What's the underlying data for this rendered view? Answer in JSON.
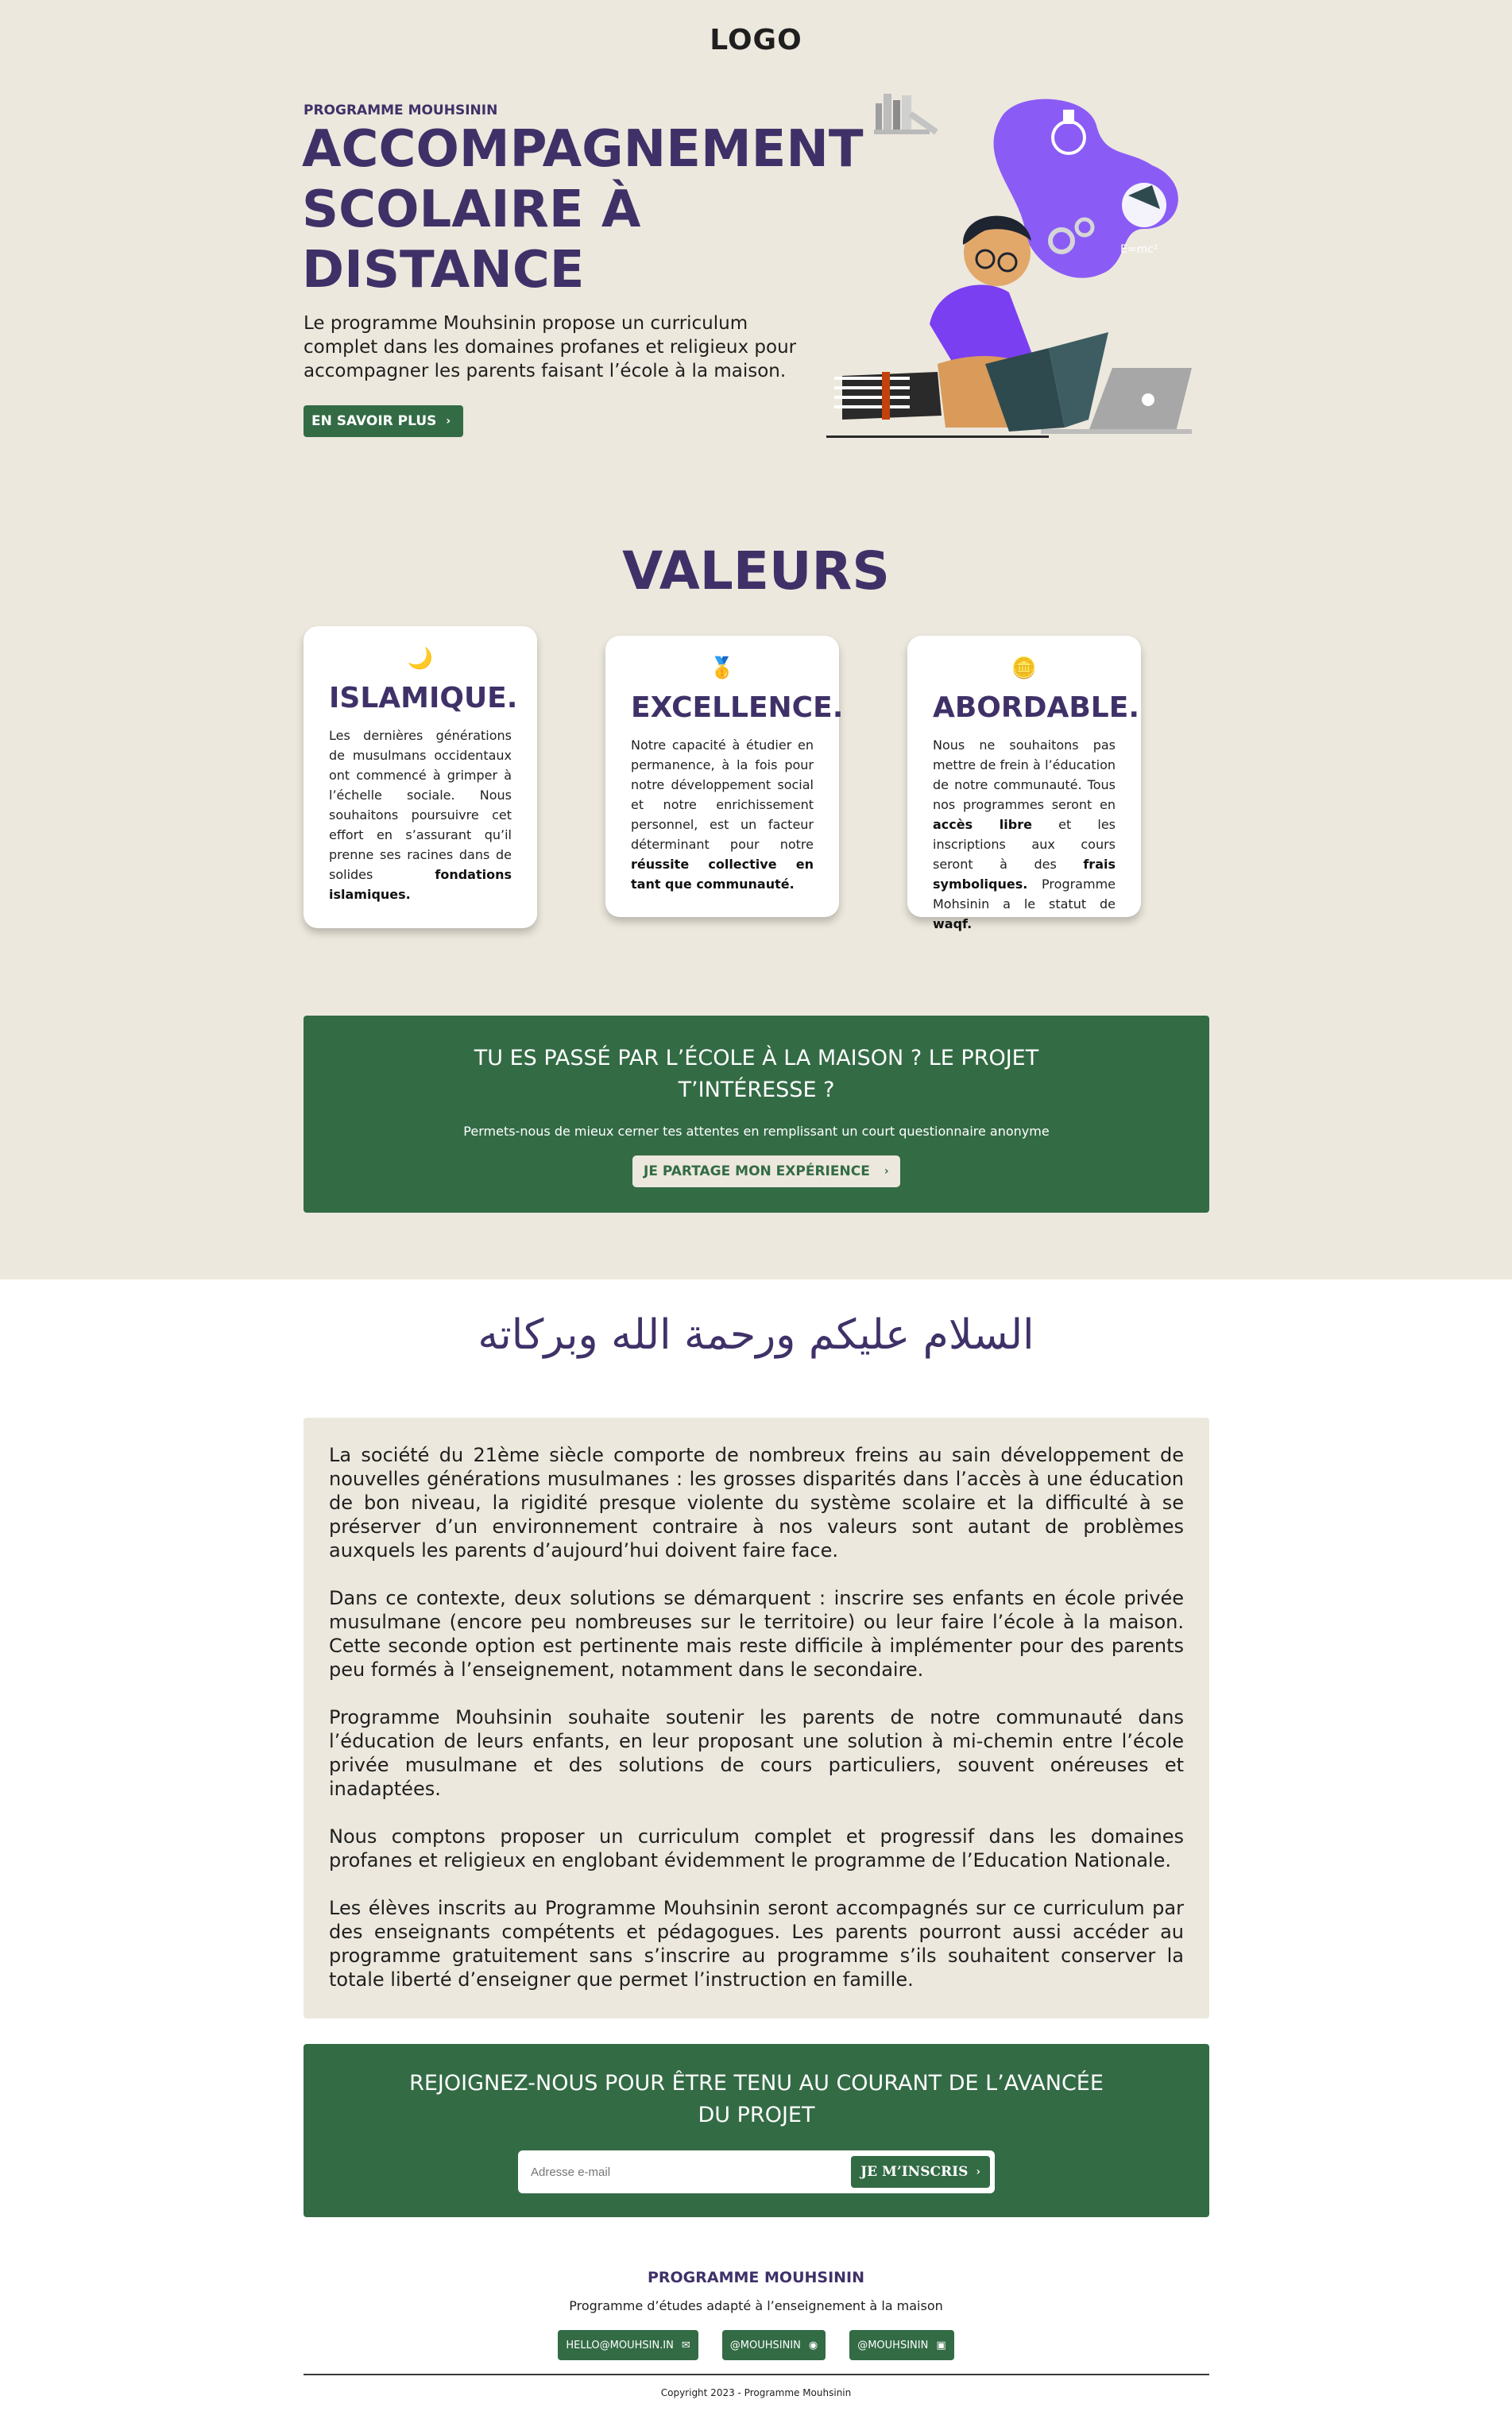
{
  "header": {
    "logo": "LOGO"
  },
  "hero": {
    "kicker": "PROGRAMME MOUHSININ",
    "title": "ACCOMPAGNEMENT SCOLAIRE À DISTANCE",
    "description": "Le programme Mouhsinin propose un curriculum complet dans les domaines profanes et religieux pour accompagner les parents faisant l’école à la maison.",
    "button_label": "EN SAVOIR PLUS"
  },
  "values": {
    "title": "VALEURS",
    "cards": [
      {
        "icon": "crescent-moon-icon",
        "title": "ISLAMIQUE.",
        "text": "Les dernières générations de musulmans occidentaux ont commencé à grimper à l’échelle sociale. Nous souhaitons poursuivre cet effort en s’assurant qu’il prenne ses racines dans de solides ",
        "bold_tail": "fondations islamiques."
      },
      {
        "icon": "medal-icon",
        "title": "EXCELLENCE.",
        "text": "Notre capacité à étudier en permanence, à la fois pour notre développement social et notre enrichissement personnel, est un facteur déterminant pour notre ",
        "bold_tail": "réussite collective en tant que communauté."
      },
      {
        "icon": "coin-icon",
        "title": "ABORDABLE.",
        "text_1": "Nous ne souhaitons pas mettre de frein à l’éducation de notre communauté. Tous nos programmes seront en ",
        "bold_1": "accès libre",
        "text_2": " et les inscriptions aux cours seront à des ",
        "bold_2": "frais symboliques.",
        "text_3": " Programme Mohsinin a le statut de ",
        "bold_3": "waqf."
      }
    ]
  },
  "cta": {
    "title_line1": "TU ES PASSÉ PAR L’ÉCOLE À LA MAISON ? LE PROJET",
    "title_line2": "T’INTÉRESSE ?",
    "subtitle": "Permets-nous de mieux cerner tes attentes en remplissant un court questionnaire anonyme",
    "button_label": "JE PARTAGE MON EXPÉRIENCE"
  },
  "greeting": {
    "arabic": "السلام عليكم ورحمة الله وبركاته"
  },
  "intro": {
    "paragraphs": [
      "La société du 21ème siècle comporte de nombreux freins au sain développement de nouvelles générations musulmanes : les grosses disparités dans l’accès à une éducation de bon niveau, la rigidité presque violente du système scolaire et la difficulté à se préserver d’un environnement contraire à nos valeurs sont autant de problèmes auxquels les parents d’aujourd’hui doivent faire face.",
      "Dans ce contexte, deux solutions se démarquent : inscrire ses enfants en école privée musulmane (encore peu nombreuses sur le territoire) ou leur faire l’école à la maison. Cette seconde option est pertinente mais reste difficile à implémenter pour des parents peu formés à l’enseignement, notamment dans le secondaire.",
      "Programme Mouhsinin souhaite soutenir les parents de notre communauté dans l’éducation de leurs enfants, en leur proposant une solution à mi-chemin entre l’école privée musulmane et des solutions de cours particuliers, souvent onéreuses et inadaptées.",
      "Nous comptons proposer un curriculum complet et progressif dans les domaines profanes et religieux en englobant évidemment le programme de l’Education Nationale.",
      "Les élèves inscrits au Programme Mouhsinin seront accompagnés sur ce curriculum par des enseignants compétents et pédagogues. Les parents pourront aussi accéder au programme gratuitement sans s’inscrire au programme s’ils souhaitent conserver la totale liberté d’enseigner que permet l’instruction en famille."
    ]
  },
  "newsletter": {
    "title_line1": "REJOIGNEZ-NOUS POUR ÊTRE TENU AU COURANT DE L’AVANCÉE",
    "title_line2": "DU PROJET",
    "email_placeholder": "Adresse e-mail",
    "button_label": "JE M’INSCRIS"
  },
  "footer": {
    "title": "PROGRAMME MOUHSININ",
    "subtitle": "Programme d’études adapté à l’enseignement à la maison",
    "links": [
      {
        "label": "HELLO@MOUHSIN.IN",
        "icon": "mail-icon"
      },
      {
        "label": "@MOUHSININ",
        "icon": "instagram-icon"
      },
      {
        "label": "@MOUHSININ",
        "icon": "facebook-icon"
      }
    ],
    "copyright": "Copyright 2023 - Programme Mouhsinin"
  },
  "colors": {
    "beige": "#ece8dd",
    "purple": "#3f3168",
    "green": "#336b45",
    "illustration_purple": "#8a5cf5"
  }
}
